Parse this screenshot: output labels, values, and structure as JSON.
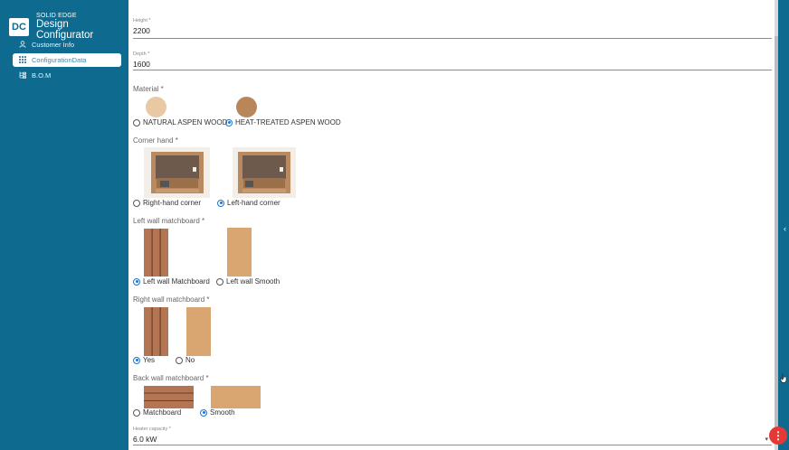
{
  "app": {
    "logo_text": "DC",
    "brand_top": "SOLID EDGE",
    "brand_bottom": "Design Configurator"
  },
  "sidebar": {
    "items": [
      {
        "label": "Customer Info",
        "icon": "user-icon",
        "active": false
      },
      {
        "label": "ConfigurationData",
        "icon": "grid-icon",
        "active": true
      },
      {
        "label": "B.O.M",
        "icon": "tree-icon",
        "active": false
      }
    ]
  },
  "form": {
    "height": {
      "label": "Height *",
      "value": "2200"
    },
    "depth": {
      "label": "Depth *",
      "value": "1600"
    },
    "material": {
      "title": "Material *",
      "options": [
        {
          "label": "NATURAL ASPEN WOOD",
          "selected": false,
          "color": "#e8c9a3"
        },
        {
          "label": "HEAT-TREATED ASPEN WOOD",
          "selected": true,
          "color": "#b9865a"
        }
      ]
    },
    "corner_hand": {
      "title": "Corner hand *",
      "options": [
        {
          "label": "Right-hand corner",
          "selected": false
        },
        {
          "label": "Left-hand corner",
          "selected": true
        }
      ]
    },
    "left_wall": {
      "title": "Left wall matchboard *",
      "options": [
        {
          "label": "Left wall Matchboard",
          "selected": true
        },
        {
          "label": "Left wall Smooth",
          "selected": false
        }
      ]
    },
    "right_wall": {
      "title": "Right wall matchboard *",
      "options": [
        {
          "label": "Yes",
          "selected": true
        },
        {
          "label": "No",
          "selected": false
        }
      ]
    },
    "back_wall": {
      "title": "Back wall matchboard *",
      "options": [
        {
          "label": "Matchboard",
          "selected": false
        },
        {
          "label": "Smooth",
          "selected": true
        }
      ]
    },
    "heater": {
      "label": "Heater capacity *",
      "value": "6.0 kW"
    }
  },
  "colors": {
    "sidebar": "#0e6b8f",
    "radio_selected": "#1976d2",
    "fab": "#e53935"
  },
  "fab_icon": "more-vertical-icon"
}
